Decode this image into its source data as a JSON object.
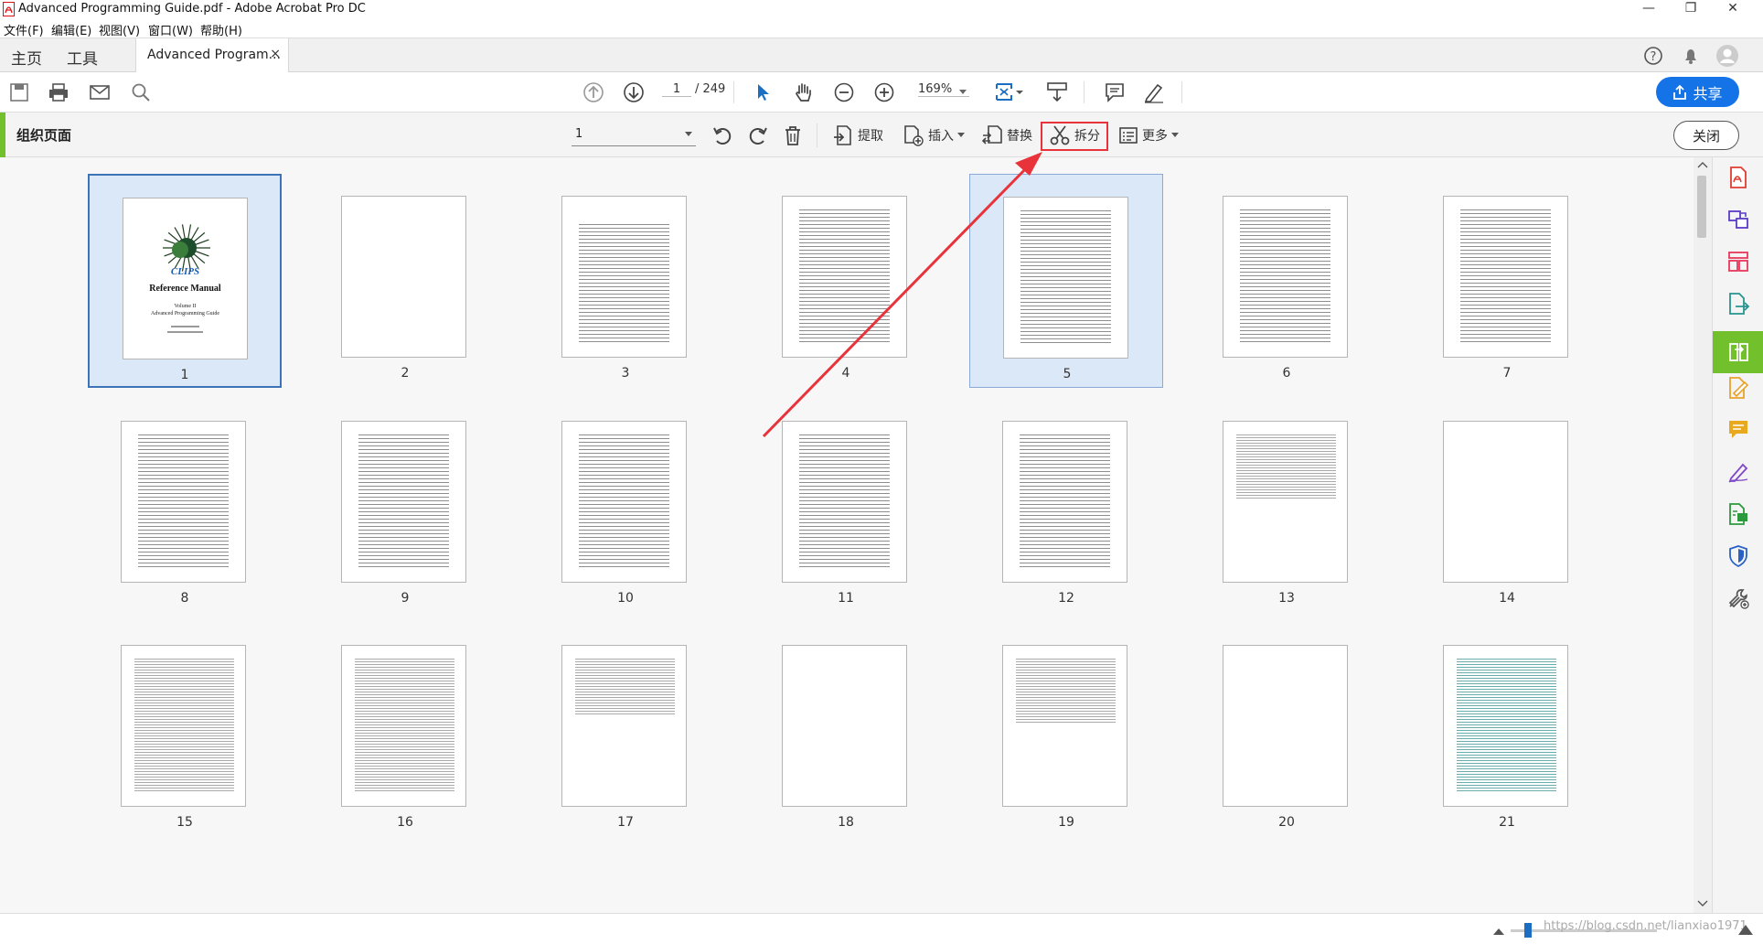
{
  "window": {
    "title": "Advanced Programming Guide.pdf - Adobe Acrobat Pro DC",
    "minimize": "—",
    "restore": "❐",
    "close": "✕"
  },
  "menu": [
    "文件(F)",
    "编辑(E)",
    "视图(V)",
    "窗口(W)",
    "帮助(H)"
  ],
  "nav": {
    "home": "主页",
    "tools": "工具",
    "doc_tab": "Advanced Program...",
    "doc_tab_close": "×"
  },
  "toolbar": {
    "page_current": "1",
    "page_total": "/ 249",
    "zoom": "169%",
    "share_label": "共享"
  },
  "organize": {
    "title": "组织页面",
    "page_range": "1",
    "extract": "提取",
    "insert": "插入",
    "replace": "替换",
    "split": "拆分",
    "more": "更多",
    "close": "关闭"
  },
  "pages": [
    {
      "num": "1",
      "kind": "cover",
      "selected": true
    },
    {
      "num": "2",
      "kind": "blank"
    },
    {
      "num": "3",
      "kind": "contents"
    },
    {
      "num": "4",
      "kind": "toc"
    },
    {
      "num": "5",
      "kind": "toc",
      "hover": true
    },
    {
      "num": "6",
      "kind": "toc"
    },
    {
      "num": "7",
      "kind": "toc"
    },
    {
      "num": "8",
      "kind": "toc"
    },
    {
      "num": "9",
      "kind": "toc"
    },
    {
      "num": "10",
      "kind": "toc"
    },
    {
      "num": "11",
      "kind": "toc"
    },
    {
      "num": "12",
      "kind": "toc"
    },
    {
      "num": "13",
      "kind": "half"
    },
    {
      "num": "14",
      "kind": "blank"
    },
    {
      "num": "15",
      "kind": "text"
    },
    {
      "num": "16",
      "kind": "text"
    },
    {
      "num": "17",
      "kind": "bullets"
    },
    {
      "num": "18",
      "kind": "blank"
    },
    {
      "num": "19",
      "kind": "half"
    },
    {
      "num": "20",
      "kind": "blank"
    },
    {
      "num": "21",
      "kind": "teal"
    }
  ],
  "cover": {
    "logo": "CLIPS",
    "title": "Reference Manual",
    "volume": "Volume II",
    "subtitle": "Advanced Programming Guide"
  },
  "watermark": "https://blog.csdn.net/lianxiao1971"
}
